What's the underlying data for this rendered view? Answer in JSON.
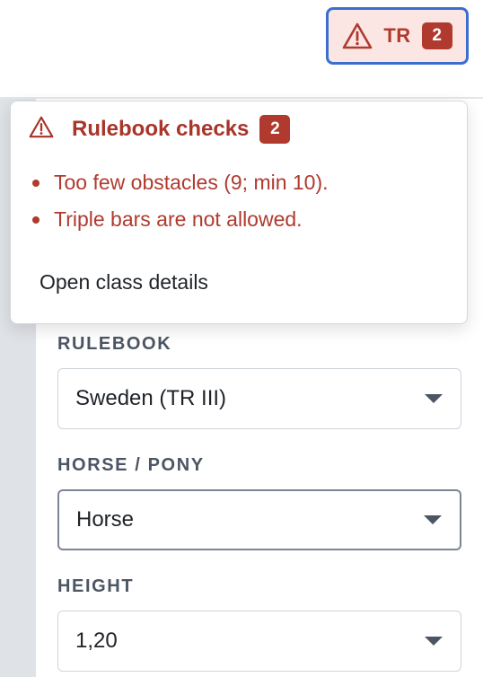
{
  "toolbar": {
    "rules_button": {
      "label": "TR",
      "count": "2",
      "icon": "warning-triangle-icon"
    }
  },
  "popover": {
    "title": "Rulebook checks",
    "count": "2",
    "icon": "warning-triangle-icon",
    "issues": [
      "Too few obstacles (9; min 10).",
      "Triple bars are not allowed."
    ],
    "link_label": "Open class details"
  },
  "form": {
    "rulebook": {
      "label": "RULEBOOK",
      "value": "Sweden (TR III)"
    },
    "horse_pony": {
      "label": "HORSE / PONY",
      "value": "Horse"
    },
    "height": {
      "label": "HEIGHT",
      "value": "1,20"
    }
  },
  "colors": {
    "error": "#b03a2e",
    "error_bg": "#fbe6e4",
    "focus_ring": "#3a6fd0",
    "label": "#4b5563",
    "rail": "#dfe2e6"
  }
}
